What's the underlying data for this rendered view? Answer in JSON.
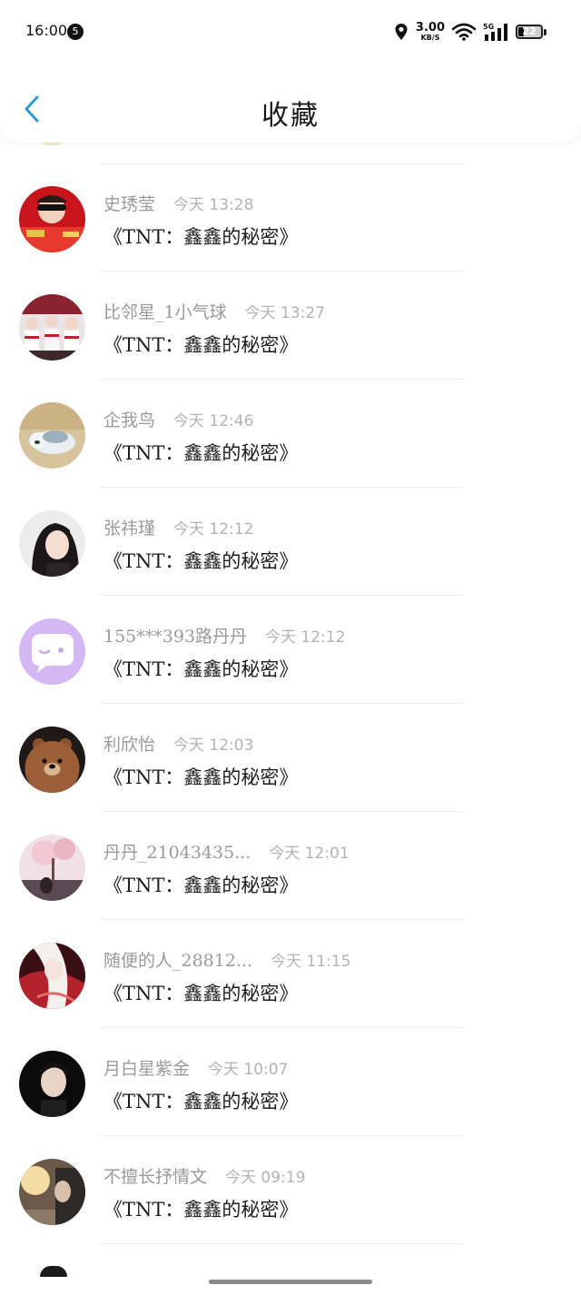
{
  "status_bar": {
    "time": "16:00",
    "notification_count": "5",
    "net_speed": "3.00",
    "net_unit": "KB/S",
    "network": "5G",
    "battery": "22"
  },
  "header": {
    "title": "收藏",
    "back_icon": "chevron-left-icon",
    "accent_color": "#2f9bd6"
  },
  "items": [
    {
      "name": "史琇莹",
      "time": "今天 13:28",
      "title": "《TNT：鑫鑫的秘密》",
      "avatar": "red-jacket-portrait"
    },
    {
      "name": "比邻星_1小气球",
      "time": "今天 13:27",
      "title": "《TNT：鑫鑫的秘密》",
      "avatar": "group-photo"
    },
    {
      "name": "企我鸟",
      "time": "今天 12:46",
      "title": "《TNT：鑫鑫的秘密》",
      "avatar": "sleeping-puppy"
    },
    {
      "name": "张祎瑾",
      "time": "今天 12:12",
      "title": "《TNT：鑫鑫的秘密》",
      "avatar": "girl-portrait"
    },
    {
      "name": "155***393路丹丹",
      "time": "今天 12:12",
      "title": "《TNT：鑫鑫的秘密》",
      "avatar": "default-chat-bubble"
    },
    {
      "name": "利欣怡",
      "time": "今天 12:03",
      "title": "《TNT：鑫鑫的秘密》",
      "avatar": "brown-bear"
    },
    {
      "name": "丹丹_21043435...",
      "time": "今天 12:01",
      "title": "《TNT：鑫鑫的秘密》",
      "avatar": "pink-tree-scene"
    },
    {
      "name": "随便的人_28812...",
      "time": "今天 11:15",
      "title": "《TNT：鑫鑫的秘密》",
      "avatar": "anime-girl"
    },
    {
      "name": "月白星紫金",
      "time": "今天 10:07",
      "title": "《TNT：鑫鑫的秘密》",
      "avatar": "boy-portrait"
    },
    {
      "name": "不擅长抒情文",
      "time": "今天 09:19",
      "title": "《TNT：鑫鑫的秘密》",
      "avatar": "sunlit-portrait"
    }
  ]
}
